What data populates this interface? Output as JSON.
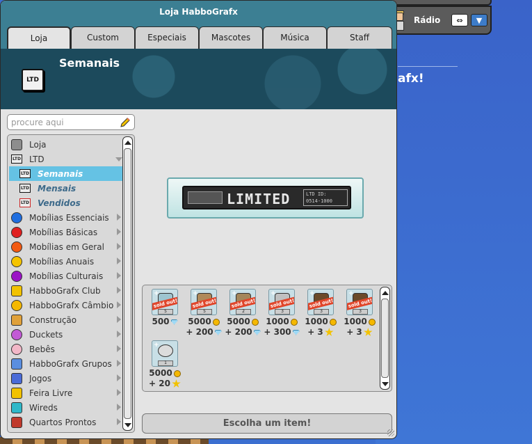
{
  "window": {
    "title": "Loja HabboGrafx"
  },
  "tabs": [
    {
      "label": "Loja"
    },
    {
      "label": "Custom"
    },
    {
      "label": "Especiais"
    },
    {
      "label": "Mascotes"
    },
    {
      "label": "Música"
    },
    {
      "label": "Staff"
    }
  ],
  "header": {
    "title": "Semanais",
    "icon": "ltd-icon",
    "icon_text": "LTD"
  },
  "search": {
    "placeholder": "procure aqui"
  },
  "sidebar": {
    "items": [
      {
        "label": "Loja",
        "icon": "shop-icon"
      },
      {
        "label": "LTD",
        "icon": "ltd-icon"
      },
      {
        "label": "Semanais",
        "icon": "ltd-icon",
        "selected": true
      },
      {
        "label": "Mensais",
        "icon": "ltd-icon"
      },
      {
        "label": "Vendidos",
        "icon": "ltd-sold-icon"
      },
      {
        "label": "Mobílias Essenciais",
        "icon": "blue-circle-icon",
        "color": "#1f6ee0"
      },
      {
        "label": "Mobílias Básicas",
        "icon": "red-circle-icon",
        "color": "#e02020"
      },
      {
        "label": "Mobílias em Geral",
        "icon": "orange-circle-icon",
        "color": "#f25a12"
      },
      {
        "label": "Mobílias Anuais",
        "icon": "yellow-circle-icon",
        "color": "#f5c400"
      },
      {
        "label": "Mobílias Culturais",
        "icon": "purple-circle-icon",
        "color": "#9b14c6"
      },
      {
        "label": "HabboGrafx Club",
        "icon": "hc-icon"
      },
      {
        "label": "HabboGrafx Câmbio",
        "icon": "exchange-coin-icon"
      },
      {
        "label": "Construção",
        "icon": "builder-icon"
      },
      {
        "label": "Duckets",
        "icon": "duckets-icon"
      },
      {
        "label": "Bebês",
        "icon": "baby-icon"
      },
      {
        "label": "HabboGrafx Grupos",
        "icon": "groups-icon"
      },
      {
        "label": "Jogos",
        "icon": "games-icon"
      },
      {
        "label": "Feira Livre",
        "icon": "marketplace-icon"
      },
      {
        "label": "Wireds",
        "icon": "wired-icon"
      },
      {
        "label": "Quartos Prontos",
        "icon": "room-bundle-icon"
      }
    ]
  },
  "preview": {
    "word": "LIMITED",
    "info_line1": "LTD ID:",
    "info_line2": "0514-1000"
  },
  "products": [
    {
      "badge": "sold out!",
      "count": "5",
      "price": "500",
      "currency": "diamond",
      "extra": ""
    },
    {
      "badge": "sold out!",
      "count": "5",
      "price": "5000",
      "currency": "coin",
      "extra": "+ 200",
      "extra_currency": "diamond"
    },
    {
      "badge": "sold out!",
      "count": "2",
      "price": "5000",
      "currency": "coin",
      "extra": "+ 200",
      "extra_currency": "diamond"
    },
    {
      "badge": "sold out!",
      "count": "3",
      "price": "1000",
      "currency": "coin",
      "extra": "+ 300",
      "extra_currency": "diamond"
    },
    {
      "badge": "sold out!",
      "count": "3",
      "price": "1000",
      "currency": "coin",
      "extra": "+ 3",
      "extra_currency": "star"
    },
    {
      "badge": "sold out!",
      "count": "3",
      "price": "1000",
      "currency": "coin",
      "extra": "+ 3",
      "extra_currency": "star"
    },
    {
      "badge": "",
      "count": "1",
      "price": "5000",
      "currency": "coin",
      "extra": "+ 20",
      "extra_currency": "star"
    }
  ],
  "choose_button": "Escolha um item!",
  "radio": {
    "label": "Rádio"
  },
  "background": {
    "partial_text": "afx!"
  },
  "colors": {
    "titlebar": "#3c7f93",
    "selected": "#65c2e4",
    "header_bg": "#1c4a5c"
  }
}
